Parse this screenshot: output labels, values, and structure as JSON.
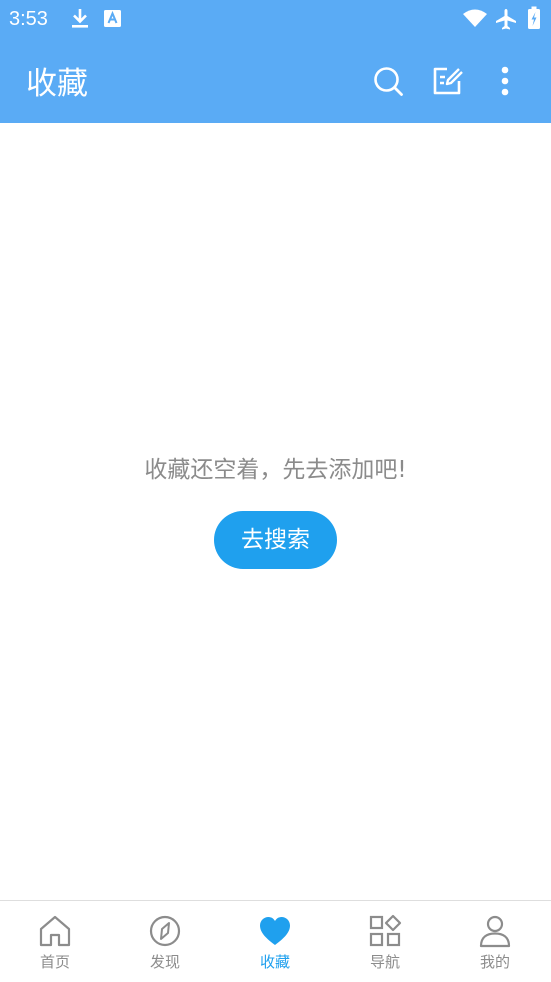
{
  "status_bar": {
    "time": "3:53",
    "icons": [
      "download-icon",
      "text-a-icon",
      "wifi-icon",
      "airplane-icon",
      "battery-icon"
    ]
  },
  "app_bar": {
    "title": "收藏",
    "actions": [
      "search-icon",
      "edit-icon",
      "more-vert-icon"
    ]
  },
  "empty_state": {
    "message": "收藏还空着，先去添加吧!",
    "button_label": "去搜索"
  },
  "bottom_nav": {
    "items": [
      {
        "label": "首页",
        "icon": "home-icon"
      },
      {
        "label": "发现",
        "icon": "compass-icon"
      },
      {
        "label": "收藏",
        "icon": "heart-icon"
      },
      {
        "label": "导航",
        "icon": "grid-icon"
      },
      {
        "label": "我的",
        "icon": "person-icon"
      }
    ],
    "active_index": 2
  },
  "colors": {
    "header": "#5aabf5",
    "accent": "#1fa0ee",
    "inactive": "#8c8c8c",
    "empty_text": "#8b8b8b"
  }
}
